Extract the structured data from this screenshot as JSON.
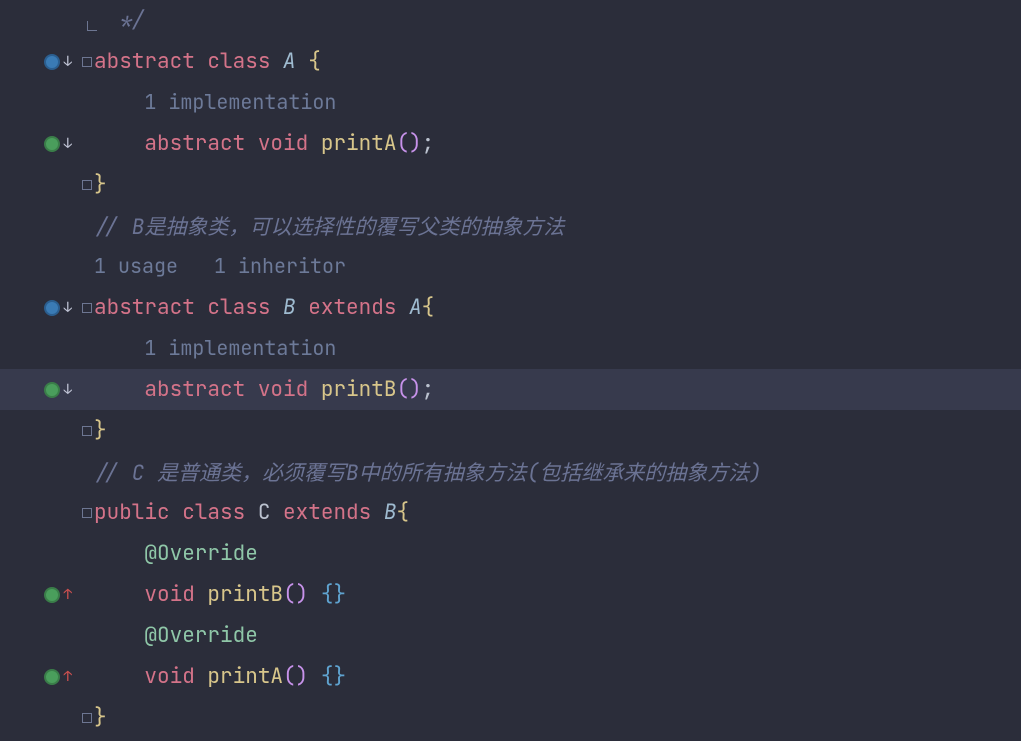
{
  "lines": {
    "l0_comment_close": "*/",
    "l1": {
      "kw1": "abstract",
      "kw2": "class",
      "type": "A",
      "brace": "{"
    },
    "l2_inlay": "1 implementation",
    "l3": {
      "kw1": "abstract",
      "kw2": "void",
      "method": "printA",
      "paren": "()",
      "semi": ";"
    },
    "l4_brace": "}",
    "l5_comment": "// B是抽象类，可以选择性的覆写父类的抽象方法",
    "l6_usage_inherit": {
      "usage": "1 usage",
      "inheritor": "1 inheritor"
    },
    "l7": {
      "kw1": "abstract",
      "kw2": "class",
      "type1": "B",
      "kw3": "extends",
      "type2": "A",
      "brace": "{"
    },
    "l8_inlay": "1 implementation",
    "l9": {
      "kw1": "abstract",
      "kw2": "void",
      "method": "printB",
      "paren": "()",
      "semi": ";"
    },
    "l10_brace": "}",
    "l11_comment": "// C 是普通类，必须覆写B中的所有抽象方法(包括继承来的抽象方法)",
    "l12": {
      "kw1": "public",
      "kw2": "class",
      "ident": "C",
      "kw3": "extends",
      "type": "B",
      "brace": "{"
    },
    "l13_annotation": "@Override",
    "l14": {
      "kw": "void",
      "method": "printB",
      "paren": "()",
      "body": "{}"
    },
    "l15_annotation": "@Override",
    "l16": {
      "kw": "void",
      "method": "printA",
      "paren": "()",
      "body": "{}"
    },
    "l17_brace": "}"
  },
  "colors": {
    "background": "#2b2d3a",
    "highlight": "#373a4d",
    "keyword": "#d47389",
    "type": "#9fbbd0",
    "method": "#d8c68b",
    "comment": "#6b7394",
    "inlay": "#6d7a99",
    "annotation": "#8fc7a8"
  }
}
